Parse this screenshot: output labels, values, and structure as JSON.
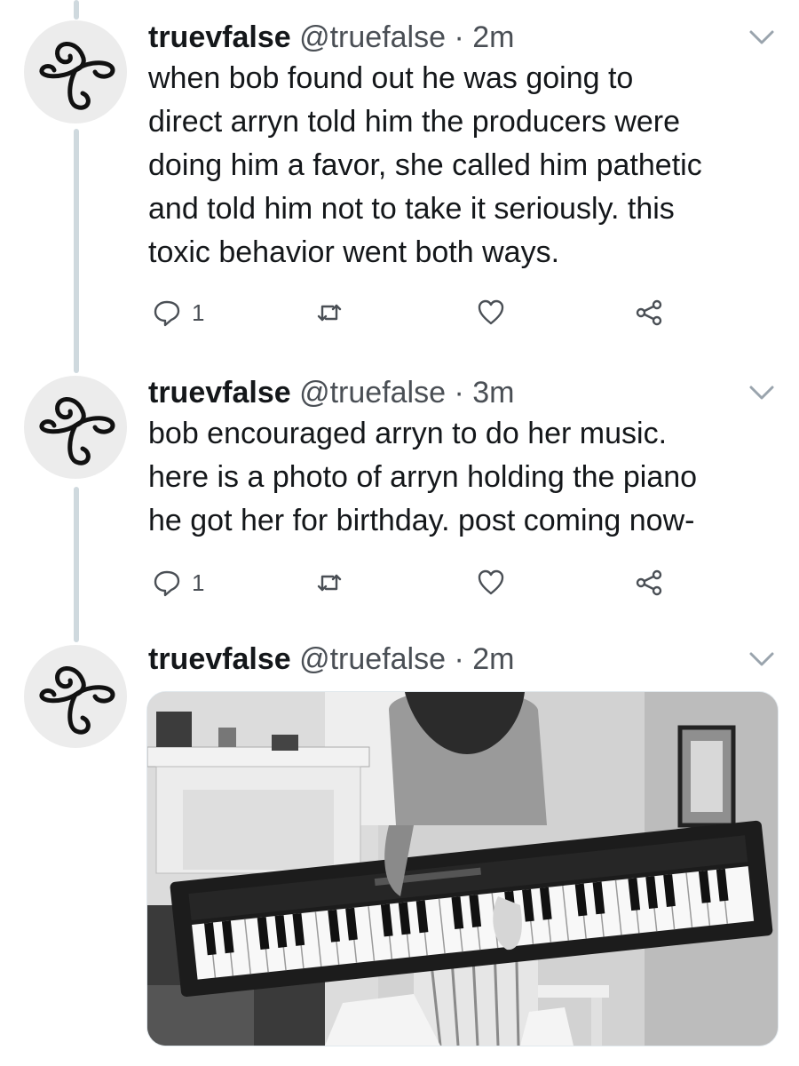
{
  "tweets": [
    {
      "name": "truevfalse",
      "handle": "@truefalse",
      "separator": "·",
      "time": "2m",
      "text": "when bob found out he was going to\ndirect arryn told him the producers were\ndoing him a favor, she called him pathetic\nand told him not to take it seriously. this\ntoxic behavior went both ways.",
      "reply_count": "1"
    },
    {
      "name": "truevfalse",
      "handle": "@truefalse",
      "separator": "·",
      "time": "3m",
      "text": "bob encouraged arryn to do her music.\nhere is a photo of arryn holding the piano\nhe got her for birthday. post coming now-",
      "reply_count": "1"
    },
    {
      "name": "truevfalse",
      "handle": "@truefalse",
      "separator": "·",
      "time": "2m"
    }
  ],
  "icons": {
    "avatar": "swirl-knot-icon",
    "reply": "reply-icon",
    "retweet": "retweet-icon",
    "like": "heart-icon",
    "share": "share-icon",
    "menu": "chevron-down-icon"
  },
  "colors": {
    "thread_line": "#cfd9de",
    "text": "#14171a",
    "secondary": "#4a4f55"
  }
}
